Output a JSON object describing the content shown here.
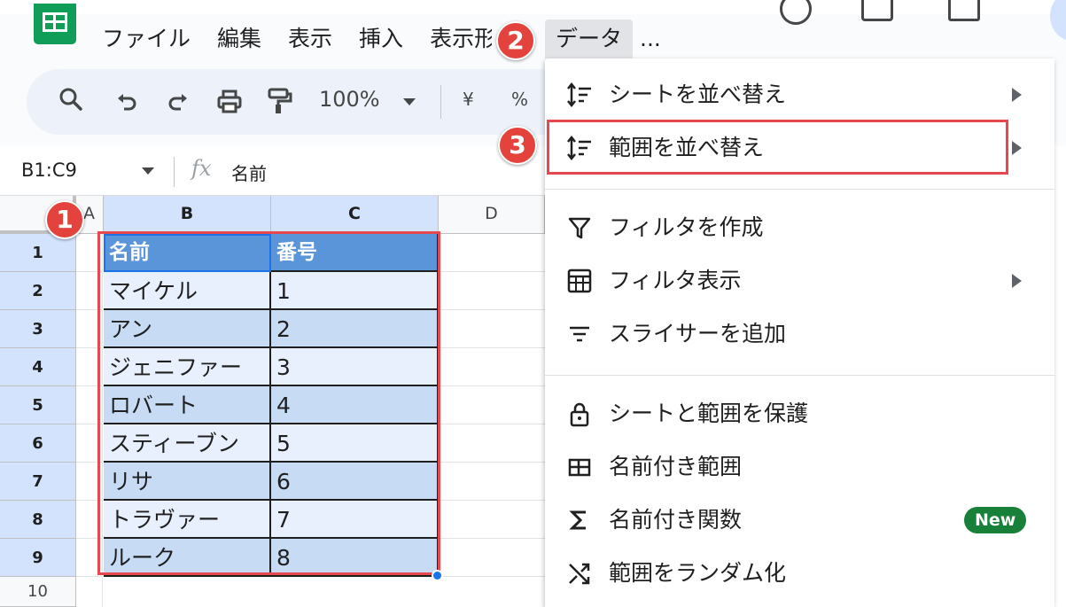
{
  "app": {
    "logo": "google-sheets-logo",
    "brand_color": "#0f9d58"
  },
  "menubar": {
    "items": [
      "ファイル",
      "編集",
      "表示",
      "挿入",
      "表示形式"
    ],
    "active": "データ",
    "more": "..."
  },
  "toolbar": {
    "icons": [
      "search-icon",
      "undo-icon",
      "redo-icon",
      "print-icon",
      "paint-format-icon"
    ],
    "zoom": "100%",
    "currency": "¥",
    "percent": "%"
  },
  "formula_bar": {
    "name_box": "B1:C9",
    "fx": "fx",
    "value": "名前"
  },
  "grid": {
    "columns": [
      "A",
      "B",
      "C",
      "D"
    ],
    "rows": [
      "1",
      "2",
      "3",
      "4",
      "5",
      "6",
      "7",
      "8",
      "9",
      "10"
    ],
    "header": [
      "名前",
      "番号"
    ],
    "data": [
      [
        "マイケル",
        "1"
      ],
      [
        "アン",
        "2"
      ],
      [
        "ジェニファー",
        "3"
      ],
      [
        "ロバート",
        "4"
      ],
      [
        "スティーブン",
        "5"
      ],
      [
        "リサ",
        "6"
      ],
      [
        "トラヴァー",
        "7"
      ],
      [
        "ルーク",
        "8"
      ]
    ],
    "header_color": "#5b95d9",
    "band_light": "#e8f0fe",
    "band_dark": "#c7dbf5"
  },
  "callouts": [
    "1",
    "2",
    "3"
  ],
  "data_menu": {
    "items": [
      {
        "label": "シートを並べ替え",
        "icon": "sort-icon",
        "submenu": true
      },
      {
        "label": "範囲を並べ替え",
        "icon": "sort-icon",
        "submenu": true
      },
      {
        "label": "フィルタを作成",
        "icon": "filter-icon",
        "submenu": false
      },
      {
        "label": "フィルタ表示",
        "icon": "filter-view-icon",
        "submenu": true
      },
      {
        "label": "スライサーを追加",
        "icon": "slicer-icon",
        "submenu": false
      },
      {
        "label": "シートと範囲を保護",
        "icon": "lock-icon",
        "submenu": false
      },
      {
        "label": "名前付き範囲",
        "icon": "named-range-icon",
        "submenu": false
      },
      {
        "label": "名前付き関数",
        "icon": "sigma-icon",
        "submenu": false,
        "badge": "New"
      },
      {
        "label": "範囲をランダム化",
        "icon": "shuffle-icon",
        "submenu": false
      }
    ],
    "highlight_color": "#e5484d"
  }
}
